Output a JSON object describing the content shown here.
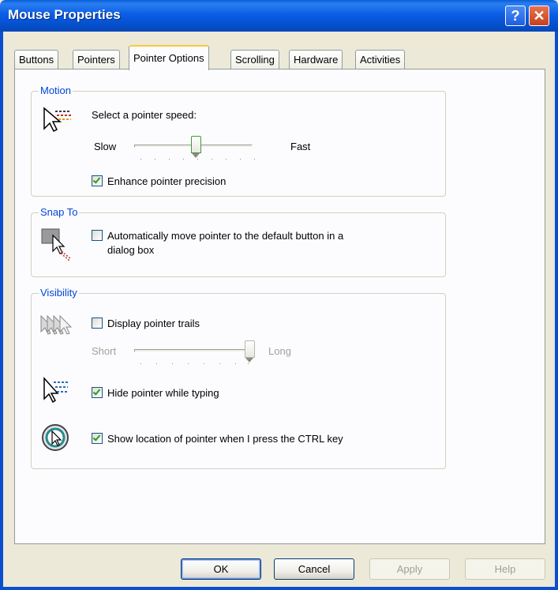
{
  "window": {
    "title": "Mouse Properties",
    "help_glyph": "?",
    "close_glyph": "✕"
  },
  "tabs": [
    {
      "label": "Buttons",
      "active": false
    },
    {
      "label": "Pointers",
      "active": false
    },
    {
      "label": "Pointer Options",
      "active": true
    },
    {
      "label": "Scrolling",
      "active": false
    },
    {
      "label": "Hardware",
      "active": false
    },
    {
      "label": "Activities",
      "active": false
    }
  ],
  "motion": {
    "legend": "Motion",
    "speed_label": "Select a pointer speed:",
    "slow_label": "Slow",
    "fast_label": "Fast",
    "speed_value": 0.5,
    "precision_label": "Enhance pointer precision",
    "precision_checked": true
  },
  "snap_to": {
    "legend": "Snap To",
    "auto_move_label_1": "Automatically move pointer to the default button in a",
    "auto_move_label_2": "dialog box",
    "auto_move_checked": false
  },
  "visibility": {
    "legend": "Visibility",
    "trails_label": "Display pointer trails",
    "trails_checked": false,
    "short_label": "Short",
    "long_label": "Long",
    "trail_length_value": 1.0,
    "hide_label": "Hide pointer while typing",
    "hide_checked": true,
    "ctrl_label": "Show location of pointer when I press the CTRL key",
    "ctrl_checked": true
  },
  "buttons": {
    "ok": "OK",
    "cancel": "Cancel",
    "apply": "Apply",
    "help": "Help"
  },
  "colors": {
    "titlebar": "#0b5ee6",
    "legend": "#0046d5",
    "check": "#21a121",
    "active_tab_highlight": "#ffc83c"
  }
}
